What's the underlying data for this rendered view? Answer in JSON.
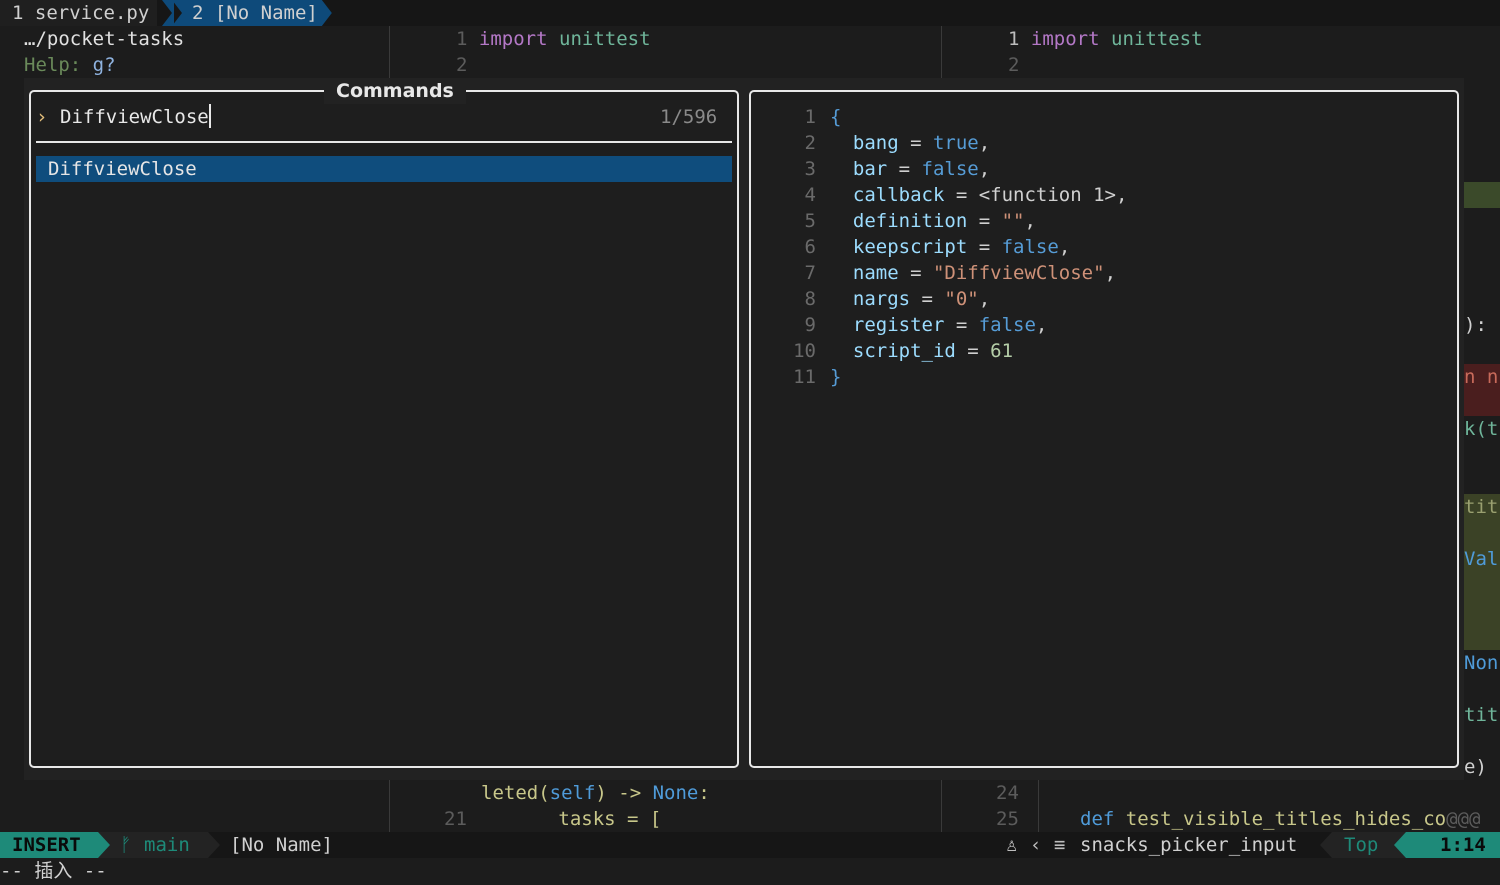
{
  "tabline": {
    "tab1": "1 service.py",
    "tab2": "2 [No Name]"
  },
  "explorer": {
    "path": "…/pocket-tasks",
    "help_label": "Help:",
    "help_key": "g?"
  },
  "left_pane": {
    "line1_num": "1",
    "line1_kw": "import",
    "line1_mod": "unittest",
    "line2_num": "2",
    "bottom_text1": "leted(",
    "bottom_self": "self",
    "bottom_text2": ") -> ",
    "bottom_none": "None",
    "bottom_colon": ":",
    "bottom_num": "21",
    "bottom_tasks": "tasks = ["
  },
  "right_pane": {
    "line1_num": "1",
    "line1_kw": "import",
    "line1_mod": "unittest",
    "line2_num": "2",
    "num24": "24",
    "num25": "25",
    "def_kw": "def",
    "def_name": "test_visible_titles_hides_co",
    "def_tail": "@@@"
  },
  "edge_fragments": [
    "):",
    "n n",
    "k(t",
    "tit",
    "Val",
    "Non",
    "tit",
    "e)"
  ],
  "picker": {
    "title": "Commands",
    "prompt_icon": "›",
    "query": "DiffviewClose",
    "count": "1/596",
    "results": [
      "DiffviewClose"
    ]
  },
  "preview": {
    "lines": [
      {
        "n": "1",
        "tokens": [
          [
            "{",
            "bool"
          ]
        ]
      },
      {
        "n": "2",
        "tokens": [
          [
            "  bang",
            "prop"
          ],
          [
            " = ",
            "plain"
          ],
          [
            "true",
            "bool"
          ],
          [
            ",",
            "plain"
          ]
        ]
      },
      {
        "n": "3",
        "tokens": [
          [
            "  bar",
            "prop"
          ],
          [
            " = ",
            "plain"
          ],
          [
            "false",
            "bool"
          ],
          [
            ",",
            "plain"
          ]
        ]
      },
      {
        "n": "4",
        "tokens": [
          [
            "  callback",
            "prop"
          ],
          [
            " = <function 1>,",
            "plain"
          ]
        ]
      },
      {
        "n": "5",
        "tokens": [
          [
            "  definition",
            "prop"
          ],
          [
            " = ",
            "plain"
          ],
          [
            "\"\"",
            "str"
          ],
          [
            ",",
            "plain"
          ]
        ]
      },
      {
        "n": "6",
        "tokens": [
          [
            "  keepscript",
            "prop"
          ],
          [
            " = ",
            "plain"
          ],
          [
            "false",
            "bool"
          ],
          [
            ",",
            "plain"
          ]
        ]
      },
      {
        "n": "7",
        "tokens": [
          [
            "  name",
            "prop"
          ],
          [
            " = ",
            "plain"
          ],
          [
            "\"DiffviewClose\"",
            "str"
          ],
          [
            ",",
            "plain"
          ]
        ]
      },
      {
        "n": "8",
        "tokens": [
          [
            "  nargs",
            "prop"
          ],
          [
            " = ",
            "plain"
          ],
          [
            "\"0\"",
            "str"
          ],
          [
            ",",
            "plain"
          ]
        ]
      },
      {
        "n": "9",
        "tokens": [
          [
            "  register",
            "prop"
          ],
          [
            " = ",
            "plain"
          ],
          [
            "false",
            "bool"
          ],
          [
            ",",
            "plain"
          ]
        ]
      },
      {
        "n": "10",
        "tokens": [
          [
            "  script_id",
            "prop"
          ],
          [
            " = ",
            "plain"
          ],
          [
            "61",
            "num"
          ]
        ]
      },
      {
        "n": "11",
        "tokens": [
          [
            "}",
            "bool"
          ]
        ]
      }
    ]
  },
  "statusline": {
    "mode": "INSERT",
    "branch_icon": "ᚠ",
    "branch": "main",
    "file": "[No Name]",
    "os_icon": "♙",
    "filetype_icon": "≡",
    "filetype": "snacks_picker_input",
    "scroll": "Top",
    "position": "1:14"
  },
  "cmdline": "-- 插入 --",
  "colors": {
    "accent": "#1e8a79",
    "selection": "#0f4d7d",
    "border": "#e8e8e8"
  }
}
